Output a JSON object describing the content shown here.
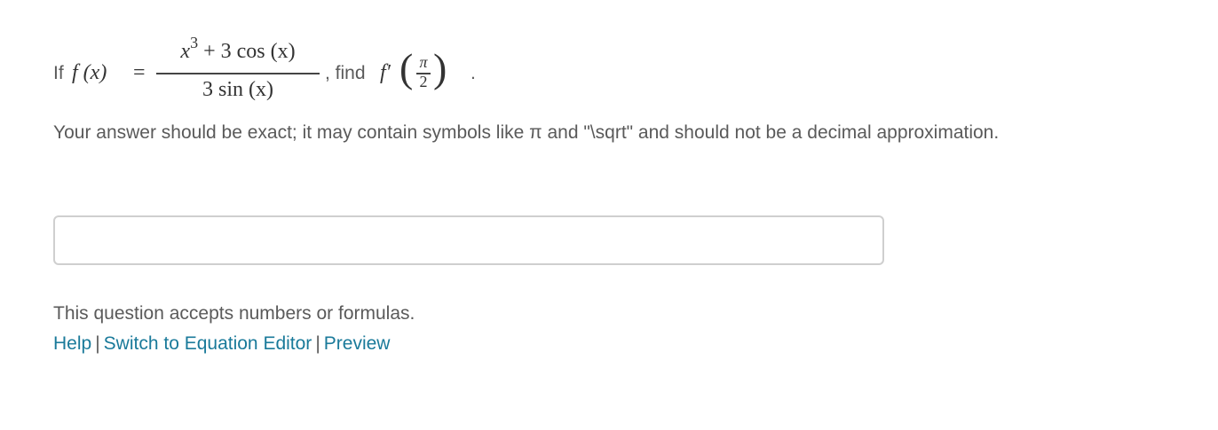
{
  "question": {
    "if_text": "If",
    "function_lhs": "f (x)",
    "equals": "=",
    "numerator_base": "x",
    "numerator_exp": "3",
    "numerator_rest": " + 3 cos (x)",
    "denominator": "3 sin (x)",
    "find_text": ", find",
    "derivative": "f′",
    "paren_left": "(",
    "paren_right": ")",
    "arg_numerator": "π",
    "arg_denominator": "2",
    "end_period": "."
  },
  "instructions": "Your answer should be exact; it may contain symbols like π and \"\\sqrt\" and should not be a decimal approximation.",
  "answer": {
    "value": "",
    "placeholder": ""
  },
  "footer": {
    "accepts_text": "This question accepts numbers or formulas.",
    "links": [
      {
        "label": "Help"
      },
      {
        "label": "Switch to Equation Editor"
      },
      {
        "label": "Preview"
      }
    ],
    "separator": "|"
  },
  "colors": {
    "text": "#5a5a5a",
    "link": "#1a7a9a",
    "input_border": "#cfcfcf"
  }
}
